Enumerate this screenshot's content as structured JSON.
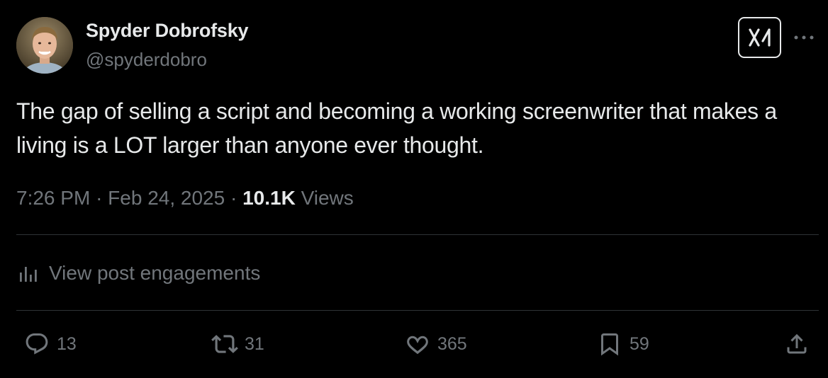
{
  "author": {
    "display_name": "Spyder Dobrofsky",
    "handle": "@spyderdobro",
    "avatar_icon": "user-avatar-photo"
  },
  "header_actions": {
    "grok_icon": "grok-logo-icon",
    "more_icon": "more-horizontal-icon"
  },
  "post": {
    "text": "The gap of selling a script and becoming a working screenwriter that makes a living is a LOT larger than anyone ever thought."
  },
  "meta": {
    "time": "7:26 PM",
    "separator": "·",
    "date": "Feb 24, 2025",
    "views_count": "10.1K",
    "views_label": "Views"
  },
  "engagements": {
    "label": "View post engagements",
    "icon": "analytics-bars-icon"
  },
  "actions": {
    "replies": {
      "icon": "reply-icon",
      "count": "13"
    },
    "reposts": {
      "icon": "repost-icon",
      "count": "31"
    },
    "likes": {
      "icon": "heart-icon",
      "count": "365"
    },
    "bookmarks": {
      "icon": "bookmark-icon",
      "count": "59"
    },
    "share": {
      "icon": "share-icon"
    }
  },
  "colors": {
    "background": "#000000",
    "primary_text": "#e7e9ea",
    "secondary_text": "#71767b",
    "divider": "#2f3336"
  }
}
